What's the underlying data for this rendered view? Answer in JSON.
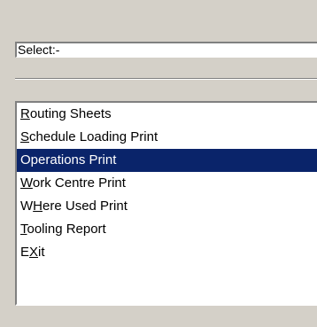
{
  "select_field": {
    "value": "Select:-"
  },
  "menu": {
    "selected_index": 2,
    "items": [
      {
        "mnemonic": "R",
        "rest": "outing Sheets"
      },
      {
        "mnemonic": "S",
        "rest": "chedule Loading Print"
      },
      {
        "mnemonic": "",
        "rest": "Operations Print"
      },
      {
        "mnemonic": "W",
        "rest": "ork Centre Print"
      },
      {
        "prefix": "W",
        "mnemonic": "H",
        "rest": "ere Used Print"
      },
      {
        "mnemonic": "T",
        "rest": "ooling Report"
      },
      {
        "prefix": "E",
        "mnemonic": "X",
        "rest": "it"
      }
    ]
  },
  "colors": {
    "background": "#d4d0c8",
    "selection": "#0a246a",
    "selection_text": "#ffffff"
  }
}
